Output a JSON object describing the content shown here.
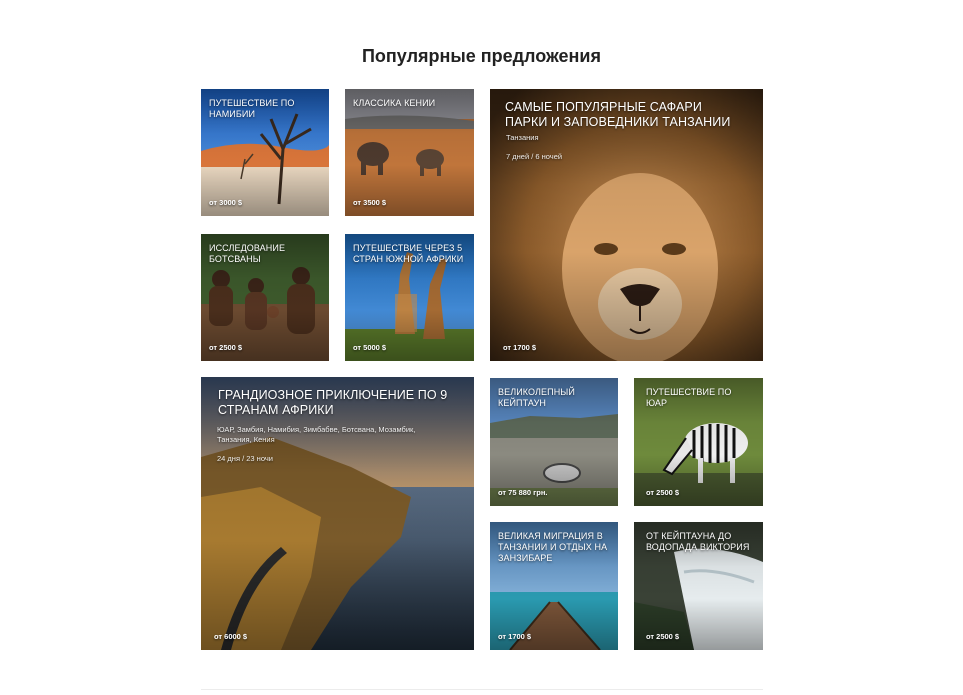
{
  "section": {
    "title": "Популярные предложения"
  },
  "cards": [
    {
      "title": "Путешествие по Намибии",
      "price": "от 3000 $"
    },
    {
      "title": "Классика Кении",
      "price": "от 3500 $"
    },
    {
      "title": "Самые популярные сафари парки и заповедники Танзании",
      "subtitle": "Танзания",
      "duration": "7 дней / 6 ночей",
      "price": "от 1700 $"
    },
    {
      "title": "Исследование Ботсваны",
      "price": "от 2500 $"
    },
    {
      "title": "Путешествие через 5 стран Южной Африки",
      "price": "от 5000 $"
    },
    {
      "title": "Грандиозное приключение по 9 странам Африки",
      "subtitle": "ЮАР, Замбия, Намибия, Зимбабве, Ботсвана, Мозамбик, Танзания, Кения",
      "duration": "24 дня / 23 ночи",
      "price": "от 6000 $"
    },
    {
      "title": "Великолепный Кейптаун",
      "price": "от 75 880 грн."
    },
    {
      "title": "Путешествие по ЮАР",
      "price": "от 2500 $"
    },
    {
      "title": "Великая миграция в Танзании и отдых на Занзибаре",
      "price": "от 1700 $"
    },
    {
      "title": "От Кейптауна до водопада Виктория",
      "price": "от 2500 $"
    }
  ]
}
